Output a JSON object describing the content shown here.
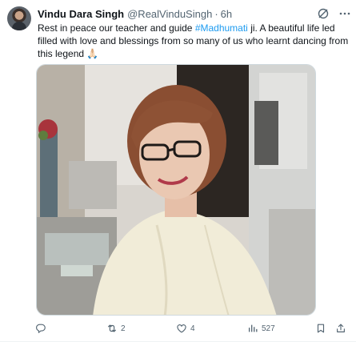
{
  "tweet": {
    "author_name": "Vindu Dara Singh",
    "handle": "@RealVinduSingh",
    "separator": "·",
    "time": "6h",
    "text_before": "Rest in peace our teacher and guide ",
    "hashtag": "#Madhumati",
    "text_after": " ji. A beautiful life led filled with love and blessings from so many of us who learnt dancing from this legend 🙏🏻",
    "media_description_icon": "photo-of-elderly-woman",
    "more_icon": "more-icon"
  },
  "actions": {
    "reply": {
      "icon": "reply-icon",
      "count": ""
    },
    "retweet": {
      "icon": "retweet-icon",
      "count": "2"
    },
    "like": {
      "icon": "like-icon",
      "count": "4"
    },
    "views": {
      "icon": "views-icon",
      "count": "527"
    },
    "bookmark": {
      "icon": "bookmark-icon"
    },
    "share": {
      "icon": "share-icon"
    }
  },
  "colors": {
    "text": "#0f1419",
    "secondary": "#536471",
    "link": "#1d9bf0",
    "border": "#cfd9de"
  }
}
